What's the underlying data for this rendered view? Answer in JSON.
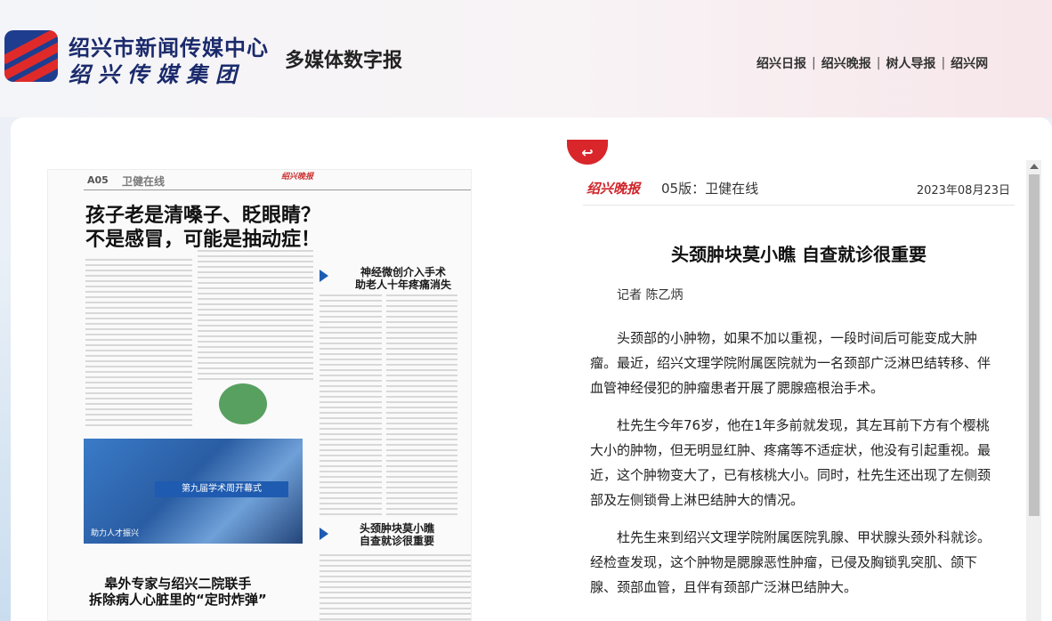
{
  "header": {
    "org_name": "绍兴市新闻传媒中心",
    "org_group": "绍兴传媒集团",
    "site_title": "多媒体数字报",
    "nav": [
      "绍兴日报",
      "绍兴晚报",
      "树人导报",
      "绍兴网"
    ]
  },
  "paper": {
    "page": "A05",
    "section": "卫健在线",
    "masthead": "绍兴晚报",
    "headline_1": "孩子老是清嗓子、眨眼睛？",
    "headline_2": "不是感冒，可能是抽动症！",
    "side_title_1a": "神经微创介入手术",
    "side_title_1b": "助老人十年疼痛消失",
    "side_title_2a": "头颈肿块莫小瞧",
    "side_title_2b": "自查就诊很重要",
    "photo_banner": "第九届学术周开幕式",
    "photo_caption": "助力人才振兴",
    "headline_3a": "皋外专家与绍兴二院联手",
    "headline_3b": "拆除病人心脏里的“定时炸弹”"
  },
  "article": {
    "back_label": "↩",
    "brand": "绍兴晚报",
    "edition": "05版：卫健在线",
    "date": "2023年08月23日",
    "title": "头颈肿块莫小瞧 自查就诊很重要",
    "author": "记者 陈乙炳",
    "paragraphs": [
      "头颈部的小肿物，如果不加以重视，一段时间后可能变成大肿瘤。最近，绍兴文理学院附属医院就为一名颈部广泛淋巴结转移、伴血管神经侵犯的肿瘤患者开展了腮腺癌根治手术。",
      "杜先生今年76岁，他在1年多前就发现，其左耳前下方有个樱桃大小的肿物，但无明显红肿、疼痛等不适症状，他没有引起重视。最近，这个肿物变大了，已有核桃大小。同时，杜先生还出现了左侧颈部及左侧锁骨上淋巴结肿大的情况。",
      "杜先生来到绍兴文理学院附属医院乳腺、甲状腺头颈外科就诊。经检查发现，这个肿物是腮腺恶性肿瘤，已侵及胸锁乳突肌、颌下腺、颈部血管，且伴有颈部广泛淋巴结肿大。"
    ]
  }
}
